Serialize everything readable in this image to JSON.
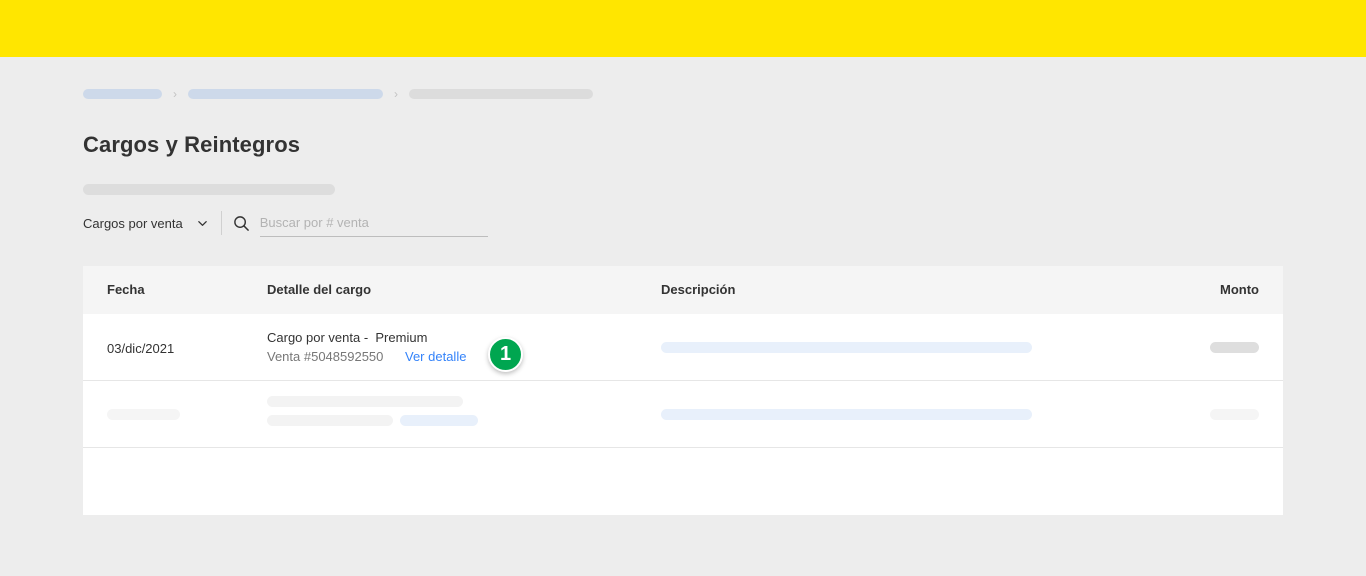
{
  "page": {
    "title": "Cargos y Reintegros"
  },
  "breadcrumb": {
    "separator": "›"
  },
  "filters": {
    "dropdown_label": "Cargos por venta",
    "search_placeholder": "Buscar por # venta"
  },
  "table": {
    "columns": [
      "Fecha",
      "Detalle del cargo",
      "Descripción",
      "Monto"
    ],
    "rows": [
      {
        "date": "03/dic/2021",
        "detail_title": "Cargo por venta -  Premium",
        "detail_sub": "Venta #5048592550",
        "detail_link": "Ver detalle",
        "step_badge": "1"
      }
    ]
  },
  "colors": {
    "header_bar": "#ffe600",
    "link": "#3483fa",
    "badge": "#00a650",
    "background": "#ededed"
  }
}
